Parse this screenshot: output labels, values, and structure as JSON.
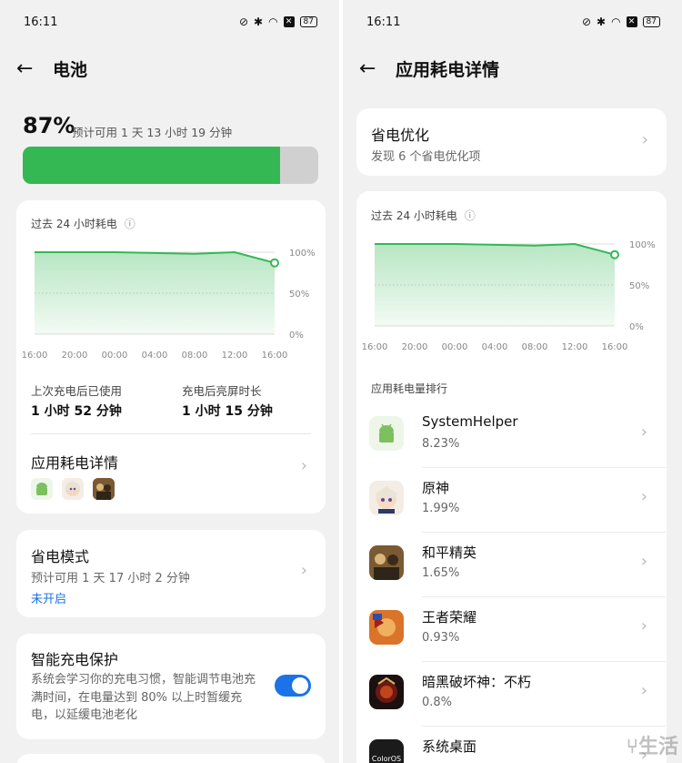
{
  "left": {
    "status": {
      "time": "16:11",
      "battery": "87"
    },
    "title": "电池",
    "battery": {
      "percent_label": "87%",
      "level": 0.87,
      "estimate": "预计可用 1 天 13 小时 19 分钟"
    },
    "usage_card": {
      "chart_title": "过去 24 小时耗电",
      "ytick_100": "100%",
      "ytick_50": "50%",
      "ytick_0": "0%",
      "xticks": [
        "16:00",
        "20:00",
        "00:00",
        "04:00",
        "08:00",
        "12:00",
        "16:00"
      ],
      "since_charge_label": "上次充电后已使用",
      "since_charge_value": "1 小时 52 分钟",
      "screen_on_label": "充电后亮屏时长",
      "screen_on_value": "1 小时 15 分钟",
      "app_details_title": "应用耗电详情"
    },
    "power_saving": {
      "title": "省电模式",
      "estimate": "预计可用 1 天 17 小时 2 分钟",
      "state": "未开启"
    },
    "smart_charge": {
      "title": "智能充电保护",
      "description": "系统会学习你的充电习惯，智能调节电池充满时间，在电量达到 80% 以上时暂缓充电，以延缓电池老化",
      "enabled": true
    }
  },
  "right": {
    "status": {
      "time": "16:11",
      "battery": "87"
    },
    "title": "应用耗电详情",
    "optimize": {
      "title": "省电优化",
      "subtitle": "发现 6 个省电优化项"
    },
    "chart_title": "过去 24 小时耗电",
    "ytick_100": "100%",
    "ytick_50": "50%",
    "ytick_0": "0%",
    "xticks": [
      "16:00",
      "20:00",
      "00:00",
      "04:00",
      "08:00",
      "12:00",
      "16:00"
    ],
    "ranking_title": "应用耗电量排行",
    "apps": [
      {
        "name": "SystemHelper",
        "percent": "8.23%",
        "icon": "android-icon"
      },
      {
        "name": "原神",
        "percent": "1.99%",
        "icon": "genshin-icon"
      },
      {
        "name": "和平精英",
        "percent": "1.65%",
        "icon": "pubg-icon"
      },
      {
        "name": "王者荣耀",
        "percent": "0.93%",
        "icon": "honor-of-kings-icon"
      },
      {
        "name": "暗黑破坏神：不朽",
        "percent": "0.8%",
        "icon": "diablo-icon"
      },
      {
        "name": "系统桌面",
        "percent": "",
        "icon": "coloros-icon"
      }
    ]
  },
  "colors": {
    "accent_green": "#34b854",
    "link_blue": "#1a73e8",
    "toggle_blue": "#1a73e8"
  },
  "chart_data": {
    "type": "area",
    "title": "过去 24 小时耗电",
    "x": [
      "16:00",
      "20:00",
      "00:00",
      "04:00",
      "08:00",
      "12:00",
      "16:00"
    ],
    "series": [
      {
        "values": [
          100,
          100,
          100,
          99,
          98,
          100,
          87
        ]
      }
    ],
    "ylim": [
      0,
      100
    ],
    "grid": true
  }
}
